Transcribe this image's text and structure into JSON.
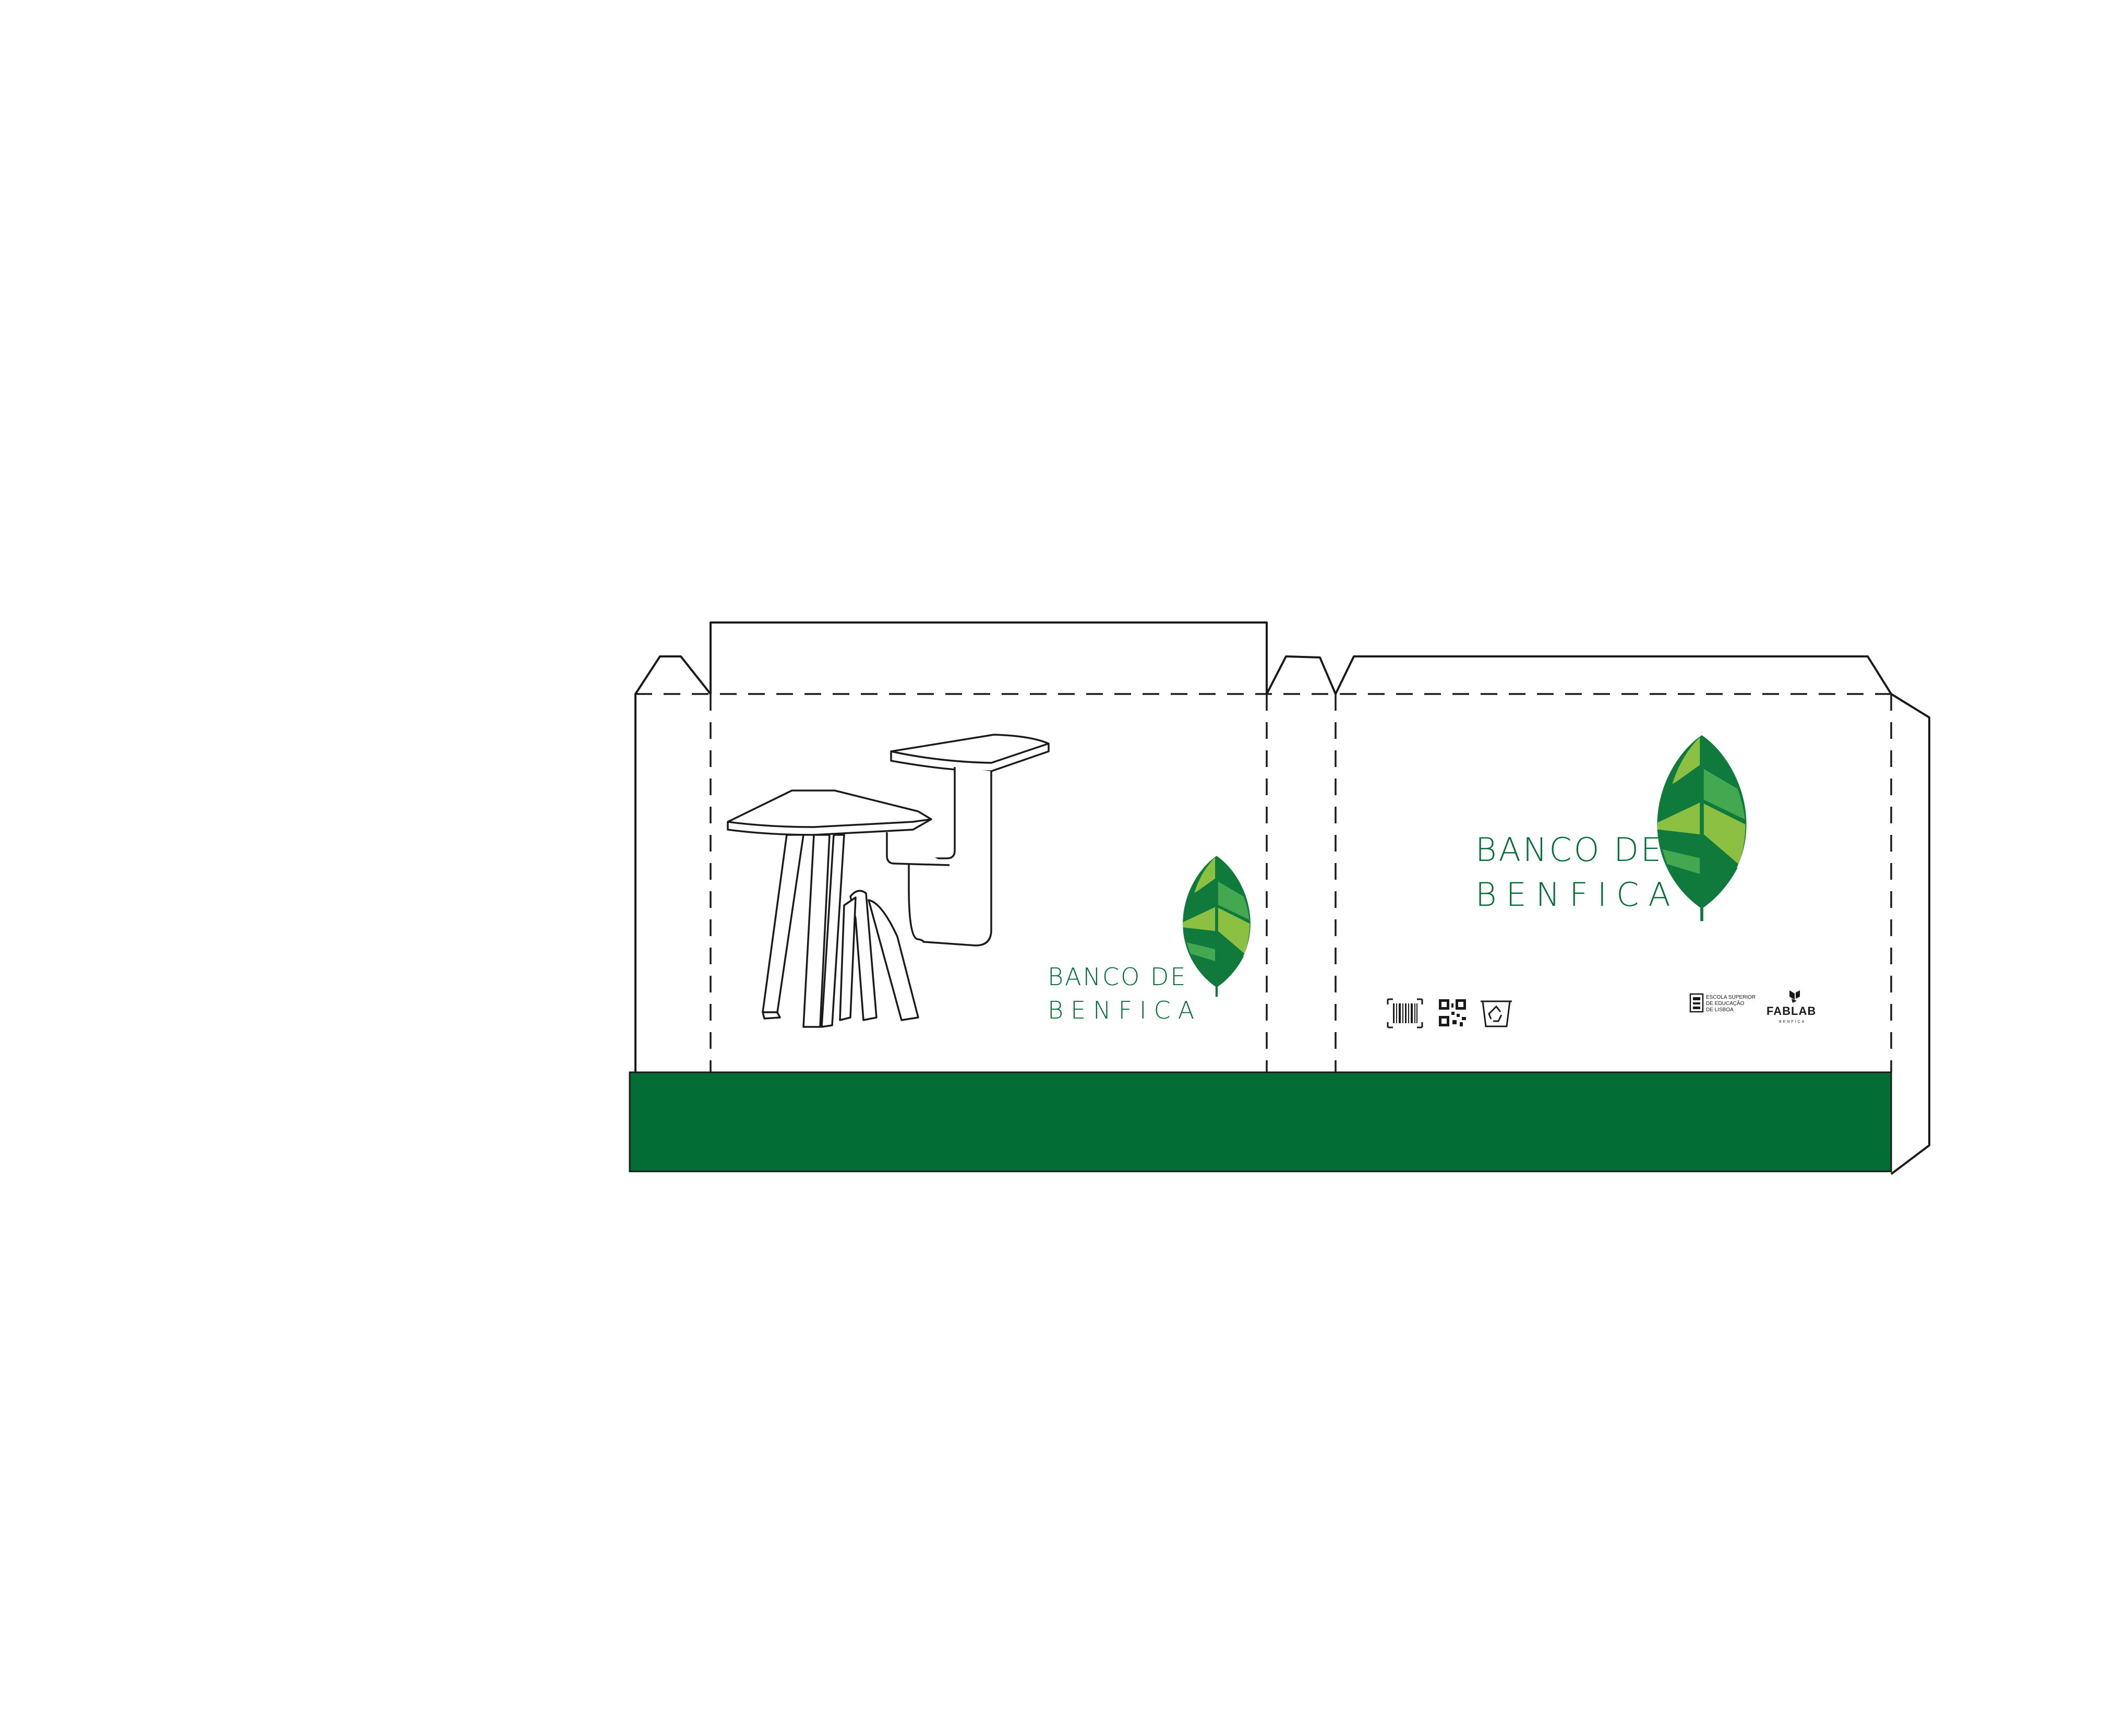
{
  "colors": {
    "background": "#ffffff",
    "outline": "#1a1a1a",
    "brand_green": "#026e36",
    "leaf_dark": "#0f7a3c",
    "leaf_mid": "#43a84f",
    "leaf_light": "#8cc043"
  },
  "front_panel": {
    "brand_line1": "BANCO DE",
    "brand_line2": "BENFICA",
    "illustration_icon": "stool-illustration",
    "logo_icon": "leaf-logo-icon"
  },
  "back_panel": {
    "brand_line1": "BANCO DE",
    "brand_line2": "BENFICA",
    "logo_icon": "leaf-logo-icon",
    "symbols": [
      "barcode-icon",
      "qr-code-icon",
      "recycle-bin-icon"
    ],
    "school_logo": {
      "icon": "school-crest-icon",
      "line1": "ESCOLA SUPERIOR",
      "line2": "DE EDUCAÇÃO",
      "line3": "DE LISBOA"
    },
    "fablab_logo": {
      "icon": "fablab-mark-icon",
      "name": "FABLAB",
      "sub": "BENFICA"
    }
  }
}
